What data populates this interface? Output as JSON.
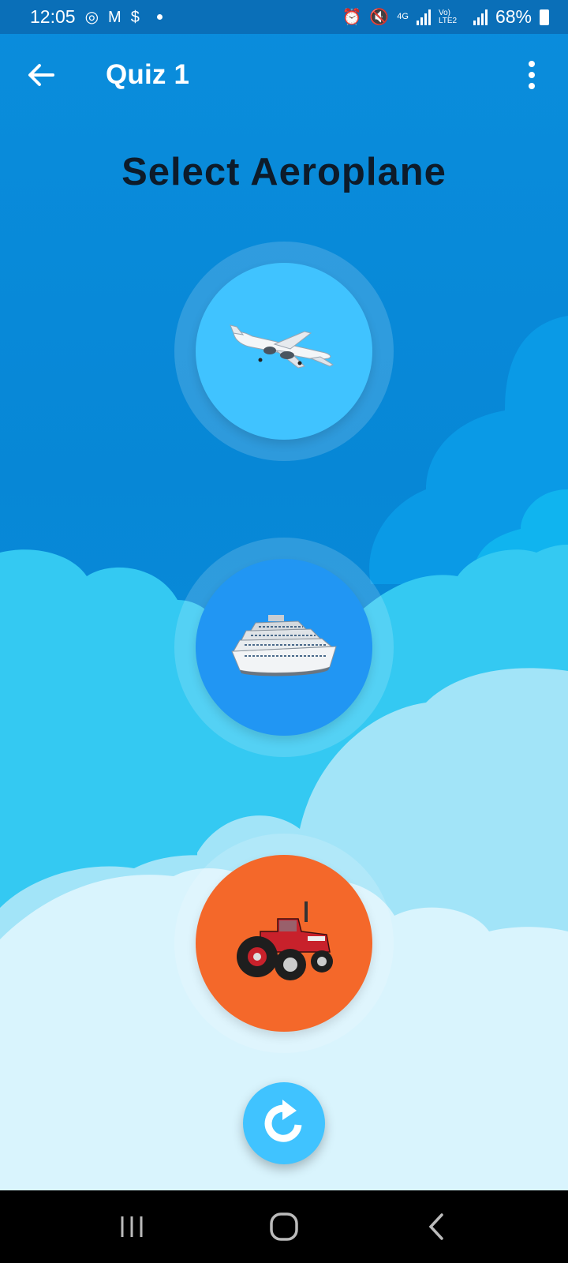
{
  "status_bar": {
    "time": "12:05",
    "battery_text": "68%",
    "network_label": "4G",
    "volte_label": "Vo) LTE2"
  },
  "app_bar": {
    "title": "Quiz 1"
  },
  "quiz": {
    "question": "Select Aeroplane",
    "options": [
      {
        "icon": "aeroplane-icon",
        "color": "#40c3ff"
      },
      {
        "icon": "ship-icon",
        "color": "#2196f3"
      },
      {
        "icon": "tractor-icon",
        "color": "#f4682a"
      }
    ]
  },
  "colors": {
    "sky": "#0a8ddc",
    "status_bar": "#0a6fb8",
    "reload_button": "#40c3ff"
  }
}
